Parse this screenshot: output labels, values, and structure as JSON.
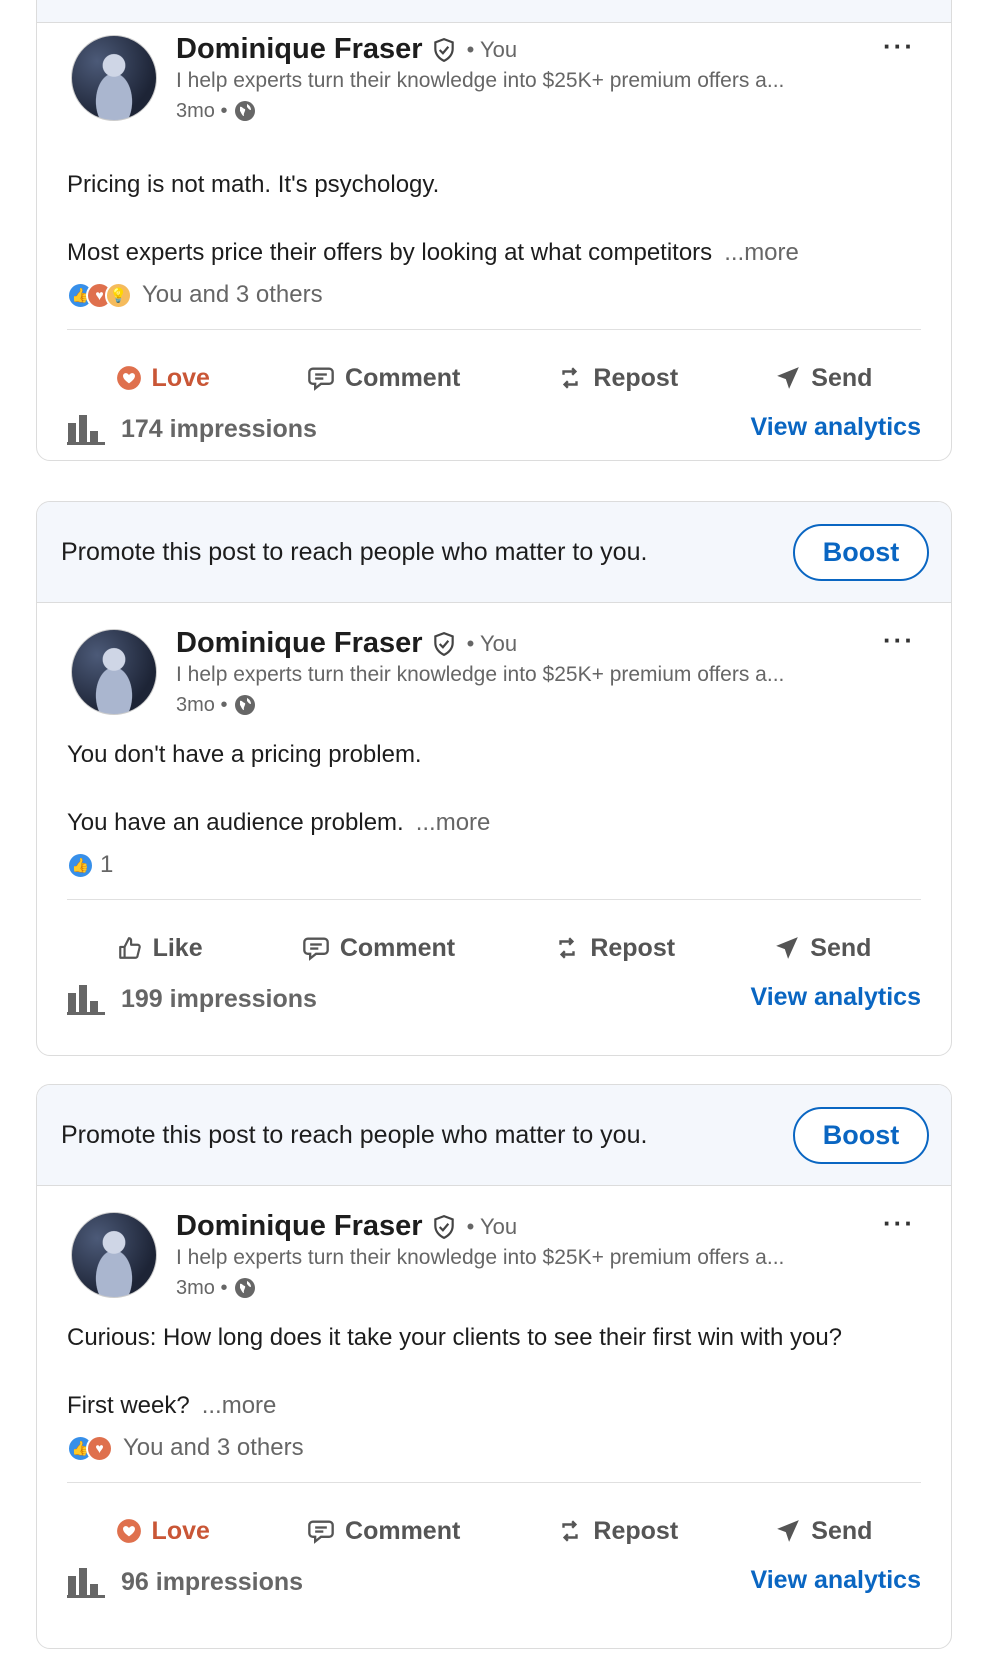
{
  "promo_text": "Promote this post to reach people who matter to you.",
  "boost_label": "Boost",
  "posts": [
    {
      "author": "Dominique Fraser",
      "you": "• You",
      "headline": "I help experts turn their knowledge into $25K+ premium offers a...",
      "age": "3mo •",
      "line1": "Pricing is not math. It's psychology.",
      "line2": "Most experts price their offers by looking at what competitors",
      "more": "...more",
      "reaction_text": "You and 3 others",
      "reactions": [
        "like-icon",
        "love-icon",
        "insightful-icon"
      ],
      "action1": "Love",
      "comment": "Comment",
      "repost": "Repost",
      "send": "Send",
      "impressions": "174 impressions",
      "analytics": "View analytics"
    },
    {
      "author": "Dominique Fraser",
      "you": "• You",
      "headline": "I help experts turn their knowledge into $25K+ premium offers a...",
      "age": "3mo •",
      "line1": "You don't have a pricing problem.",
      "line2": "You have an audience problem.",
      "more": "...more",
      "reaction_text": "1",
      "reactions": [
        "like-icon"
      ],
      "action1": "Like",
      "comment": "Comment",
      "repost": "Repost",
      "send": "Send",
      "impressions": "199 impressions",
      "analytics": "View analytics"
    },
    {
      "author": "Dominique Fraser",
      "you": "• You",
      "headline": "I help experts turn their knowledge into $25K+ premium offers a...",
      "age": "3mo •",
      "line1": "Curious: How long does it take your clients to see their first win with you?",
      "line2": "First week?",
      "more": "...more",
      "reaction_text": "You and 3 others",
      "reactions": [
        "like-icon",
        "love-icon"
      ],
      "action1": "Love",
      "comment": "Comment",
      "repost": "Repost",
      "send": "Send",
      "impressions": "96 impressions",
      "analytics": "View analytics"
    }
  ],
  "colors": {
    "link": "#0a66c2",
    "love": "#c95636",
    "promo_bg": "#f4f7fc"
  }
}
